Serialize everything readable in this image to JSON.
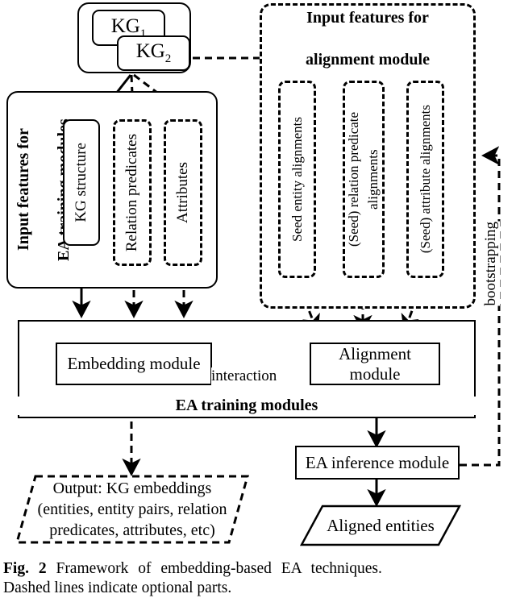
{
  "figure": {
    "label": "Fig. 2",
    "caption_line1": "Framework of embedding-based EA techniques.",
    "caption_line2": "Dashed lines indicate optional parts."
  },
  "kg_source": {
    "kg1": "KG",
    "kg1_sub": "1",
    "kg2": "KG",
    "kg2_sub": "2"
  },
  "left_panel": {
    "title_line1": "Input features for",
    "title_line2": "EA training modules",
    "boxes": [
      {
        "label": "KG structure",
        "style": "solid"
      },
      {
        "label": "Relation predicates",
        "style": "dashed"
      },
      {
        "label": "Attributes",
        "style": "dashed"
      }
    ]
  },
  "right_panel": {
    "title_line1": "Input features for",
    "title_line2": "alignment module",
    "boxes": [
      {
        "label": "Seed entity alignments",
        "style": "dashed"
      },
      {
        "label": "(Seed) relation predicate alignments",
        "style": "dashed"
      },
      {
        "label": "(Seed) attribute alignments",
        "style": "dashed"
      }
    ]
  },
  "training": {
    "embedding_module": "Embedding module",
    "alignment_module": "Alignment module",
    "interaction": "interaction",
    "container_label": "EA training modules"
  },
  "inference": {
    "module": "EA inference module",
    "result": "Aligned entities"
  },
  "output": {
    "line1": "Output: KG embeddings",
    "line2": "(entities, entity pairs, relation",
    "line3": "predicates, attributes, etc)"
  },
  "feedback": {
    "bootstrapping": "bootstrapping"
  },
  "colors": {
    "stroke": "#000000",
    "background": "#ffffff"
  }
}
